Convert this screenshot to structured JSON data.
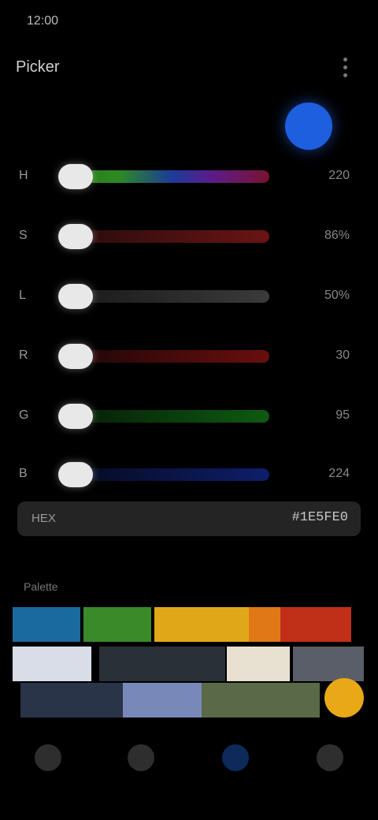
{
  "status_bar": {
    "time": "12:00"
  },
  "header": {
    "title": "Picker"
  },
  "preview": {
    "color": "#1e5fe0"
  },
  "sliders": [
    {
      "id": "hue",
      "label": "H",
      "value": "220",
      "fraction": 0.0,
      "track": "linear-gradient(90deg,#2a7a1a 0%,#2d8a22 22%,#1c3a9a 50%,#5a1c8a 70%,#7a1230 100%)"
    },
    {
      "id": "sat",
      "label": "S",
      "value": "86%",
      "fraction": 0.0,
      "track": "linear-gradient(90deg,#2a0c0c,#6a1414 100%)"
    },
    {
      "id": "light",
      "label": "L",
      "value": "50%",
      "fraction": 0.0,
      "track": "linear-gradient(90deg,#1a1a1a,#3a3a3a 100%)"
    },
    {
      "id": "red",
      "label": "R",
      "value": "30",
      "fraction": 0.0,
      "track": "linear-gradient(90deg,#200606,#6a0e0e 100%)"
    },
    {
      "id": "green",
      "label": "G",
      "value": "95",
      "fraction": 0.0,
      "track": "linear-gradient(90deg,#061e06,#0e5a12 100%)"
    },
    {
      "id": "blue",
      "label": "B",
      "value": "224",
      "fraction": 0.0,
      "track": "linear-gradient(90deg,#060a20,#0e1e6a 100%)"
    }
  ],
  "hex": {
    "label": "HEX",
    "value": "#1E5FE0"
  },
  "palette": {
    "title": "Palette"
  },
  "nav": [
    {
      "id": "nav-home",
      "color": "#3a3a3a"
    },
    {
      "id": "nav-sliders",
      "color": "#3a3a3a"
    },
    {
      "id": "nav-palette",
      "color": "#0d2a5a"
    },
    {
      "id": "nav-settings",
      "color": "#3a3a3a"
    }
  ]
}
